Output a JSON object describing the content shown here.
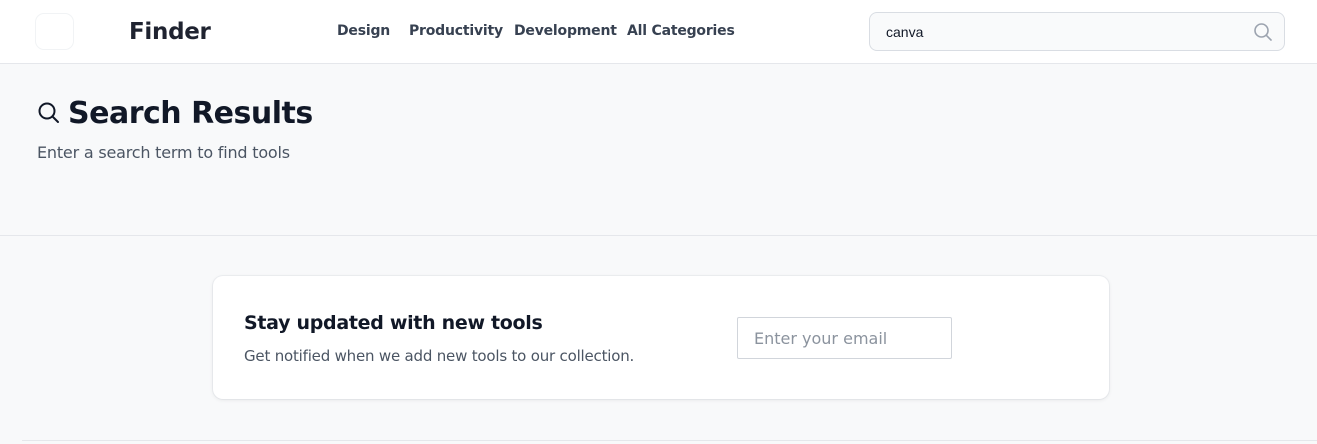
{
  "header": {
    "brand": "Finder",
    "nav": [
      "Design",
      "Productivity",
      "Development",
      "All Categories"
    ],
    "search": {
      "value": "canva",
      "icon": "search-icon"
    }
  },
  "hero": {
    "title": "Search Results",
    "title_icon": "search-icon",
    "subtitle": "Enter a search term to find tools"
  },
  "newsletter": {
    "title": "Stay updated with new tools",
    "description": "Get notified when we add new tools to our collection.",
    "email_placeholder": "Enter your email"
  }
}
